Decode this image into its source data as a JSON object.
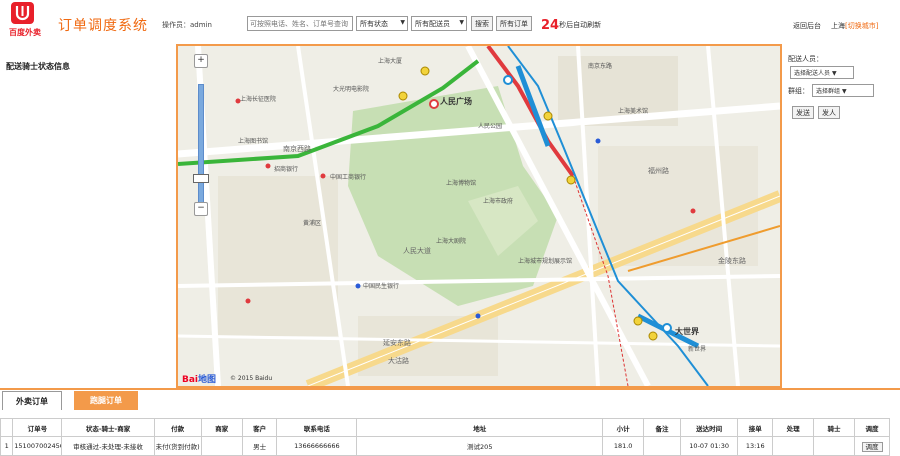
{
  "header": {
    "logo_text": "百度外卖",
    "title": "订单调度系统",
    "operator": "操作员：admin",
    "search_placeholder": "可按照电话、姓名、订单号查询",
    "status_select": "所有状态",
    "rider_select": "所有配送员",
    "search_button": "搜索",
    "all_orders_button": "所有订单",
    "refresh_seconds": "24",
    "refresh_suffix": "秒后自动刷新",
    "back_link": "返回后台",
    "city": "上海",
    "switch_city": "[切换城市]"
  },
  "left_panel": {
    "title": "配送骑士状态信息"
  },
  "map": {
    "copyright": "© 2015 Baidu",
    "baidu_logo_1": "Bai",
    "baidu_logo_2": "地图",
    "labels": {
      "l1": "人民广场",
      "l2": "上海博物馆",
      "l3": "上海大剧院",
      "l4": "上海市政府",
      "l5": "人民公园",
      "l6": "上海美术馆",
      "l7": "大世界",
      "l8": "南京东路",
      "l9": "上海长征医院",
      "l10": "黄浦区",
      "l11": "新世界",
      "l12": "大光明电影院",
      "l13": "延安东路",
      "l14": "上海城市规划展示馆",
      "l15": "福州路",
      "l16": "金陵东路",
      "l17": "上海大厦",
      "l18": "大沽路",
      "l19": "招商银行",
      "l20": "中国工商银行",
      "l21": "中国民生银行",
      "l22": "上海图书馆",
      "l23": "人民大道",
      "l24": "南京西路"
    }
  },
  "right_panel": {
    "rider_label": "配送人员：",
    "rider_select": "选择配送人员",
    "group_label": "群组：",
    "group_select": "选择群组",
    "send_button": "发送",
    "clear_button": "发人"
  },
  "tabs": [
    {
      "label": "外卖订单"
    },
    {
      "label": "跑腿订单"
    }
  ],
  "table": {
    "headers": [
      "",
      "订单号",
      "状态-骑士-商家",
      "付款",
      "商家",
      "客户",
      "联系电话",
      "地址",
      "小计",
      "备注",
      "送达时间",
      "接单",
      "处理",
      "骑士",
      "调度"
    ],
    "rows": [
      [
        "1",
        "15100700245688680",
        "审核通过-未处理-未接收",
        "未付(货到付款)",
        "",
        "男士",
        "13666666666",
        "测试205",
        "181.0",
        "",
        "10-07 01:30",
        "13:16",
        "",
        "",
        "调度"
      ]
    ]
  }
}
